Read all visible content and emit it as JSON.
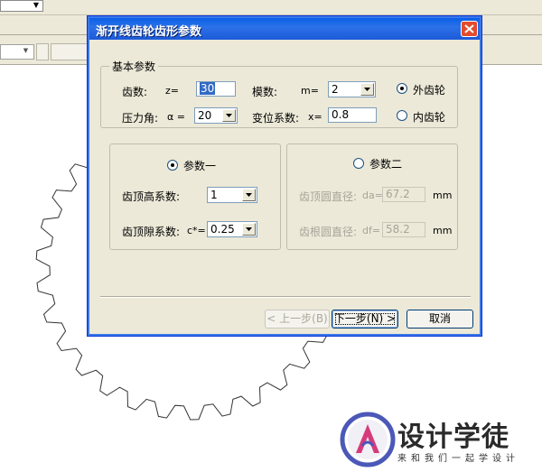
{
  "dialog": {
    "title": "渐开线齿轮齿形参数",
    "basic_group": {
      "legend": "基本参数",
      "teeth": {
        "label": "齿数:",
        "symbol": "z=",
        "value": "30"
      },
      "module": {
        "label": "模数:",
        "symbol": "m=",
        "value": "2"
      },
      "pressure_angle": {
        "label": "压力角:",
        "symbol": "α =",
        "value": "20"
      },
      "shift_coef": {
        "label": "变位系数:",
        "symbol": "x=",
        "value": "0.8"
      },
      "gear_type": {
        "external": {
          "label": "外齿轮",
          "checked": true
        },
        "internal": {
          "label": "内齿轮",
          "checked": false
        }
      }
    },
    "param1": {
      "label": "参数一",
      "checked": true,
      "addendum_coef": {
        "label": "齿顶高系数:",
        "value": "1"
      },
      "clearance_coef": {
        "label": "齿顶隙系数:",
        "symbol": "c*=",
        "value": "0.25"
      }
    },
    "param2": {
      "label": "参数二",
      "checked": false,
      "tip_diameter": {
        "label": "齿顶圆直径:",
        "symbol": "da=",
        "value": "67.2",
        "unit": "mm"
      },
      "root_diameter": {
        "label": "齿根圆直径:",
        "symbol": "df=",
        "value": "58.2",
        "unit": "mm"
      }
    },
    "buttons": {
      "back": "< 上一步(B)",
      "next": "下一步(N) >",
      "cancel": "取消"
    }
  },
  "watermark": {
    "brand": "设计学徒",
    "tagline": "来和我们一起学设计"
  },
  "colors": {
    "title_bar": "#0a5fe8",
    "dialog_bg": "#ece9d8",
    "close_button": "#e24c2e",
    "selection": "#316ac5"
  }
}
